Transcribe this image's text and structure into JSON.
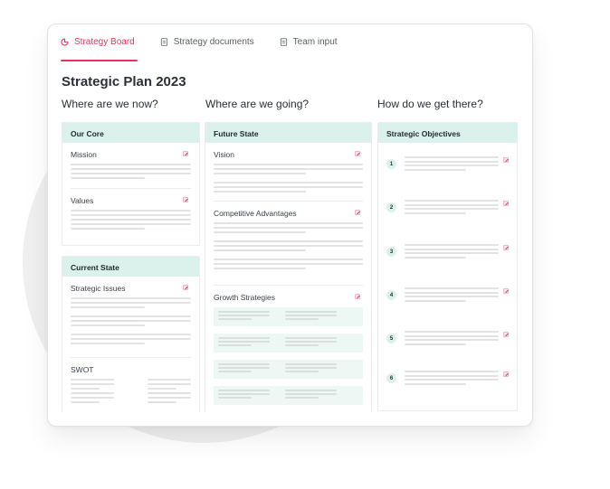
{
  "tabs": [
    {
      "label": "Strategy Board",
      "icon": "pie-chart-icon",
      "active": true
    },
    {
      "label": "Strategy documents",
      "icon": "document-icon",
      "active": false
    },
    {
      "label": "Team input",
      "icon": "document-icon",
      "active": false
    }
  ],
  "colors": {
    "accent": "#e0355c",
    "panel_header": "#daf1ec",
    "growth_box": "#edf7f4"
  },
  "page_title": "Strategic Plan 2023",
  "columns": [
    {
      "question": "Where are we now?"
    },
    {
      "question": "Where are we going?"
    },
    {
      "question": "How do we get there?"
    }
  ],
  "panels": {
    "our_core": {
      "title": "Our Core",
      "sections": [
        "Mission",
        "Values"
      ]
    },
    "current_state": {
      "title": "Current State",
      "sections": [
        "Strategic Issues",
        "SWOT"
      ]
    },
    "future_state": {
      "title": "Future State",
      "sections": [
        "Vision",
        "Competitive Advantages",
        "Growth Strategies"
      ]
    },
    "strategic_objectives": {
      "title": "Strategic Objectives",
      "items": [
        "1",
        "2",
        "3",
        "4",
        "5",
        "6"
      ]
    }
  }
}
